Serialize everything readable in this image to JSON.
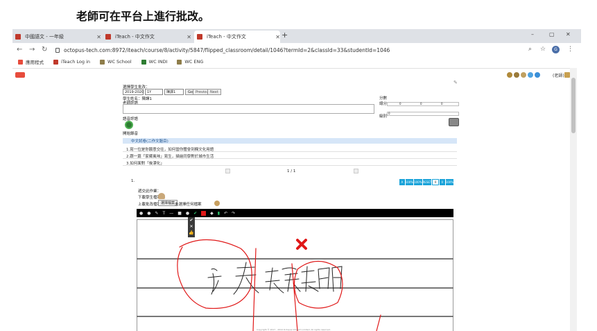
{
  "caption": "老師可在平台上進行批改。",
  "browser": {
    "tabs": [
      {
        "label": "中國語文 - 一年級",
        "active": false
      },
      {
        "label": "iTeach - 中文作文",
        "active": false
      },
      {
        "label": "iTeach - 中文作文",
        "active": true
      }
    ],
    "new_tab": "+",
    "window_controls": {
      "minimize": "–",
      "maximize": "▢",
      "close": "✕"
    },
    "url": "octopus-tech.com:8972/iteach/course/8/activity/5847/flipped_classroom/detail/1046?termId=2&classId=33&studentId=1046",
    "avatar_letter": "G",
    "bookmarks": [
      {
        "label": "應用程式",
        "color": "#e74c3c"
      },
      {
        "label": "iTeach Log in",
        "color": "#c0392b"
      },
      {
        "label": "WC School",
        "color": "#8e7d4a"
      },
      {
        "label": "WC INDI",
        "color": "#2e7d32"
      },
      {
        "label": "WC ENG",
        "color": "#8e7d4a"
      }
    ]
  },
  "app": {
    "user_label": "(老師)",
    "student_select_label": "選擇學生批改：",
    "year_option": "2019-2020",
    "class_option": "1Y",
    "student_option": "陳譯1",
    "go_label": "Go",
    "previous_label": "Previous",
    "next_label": "Next",
    "student_name": "學生姓名：陳譯1",
    "teacher_comment_label": "老師評語",
    "score_label": "分數",
    "score_total_label": "總分",
    "marks_col1": "0",
    "marks_col2": "0",
    "marks_col3": "0",
    "grade_label": "級別",
    "grade_value": "0",
    "voice_comment_label": "語音評語",
    "record_label": "開始錄音",
    "question_header": "中文試卷(二作文題目)",
    "question_lines": [
      "1.寫一位是你願意交往，如何當你體會到欄文化用語",
      "2.跟一篇「家鄉風味」寫生，描繪同學對於城市生活",
      "3.如何面對「後漂化」"
    ],
    "pagination": "1 / 1",
    "item_number": "1.",
    "blue_buttons": [
      "A",
      "100%",
      "100%",
      "RESET",
      "0",
      "0",
      "100%"
    ],
    "submit_time_label": "遞交此作業：",
    "download_label": "下載學生檔案：",
    "upload_label": "上載批改檔案：",
    "choose_file_label": "選擇檔案",
    "no_file_label": "未選擇任何檔案",
    "popup_icons": [
      "✔",
      "✕",
      "👍"
    ],
    "footer": "Copyright © 2017 - 2019 Octopus Infotech Limited. All rights reserved."
  }
}
